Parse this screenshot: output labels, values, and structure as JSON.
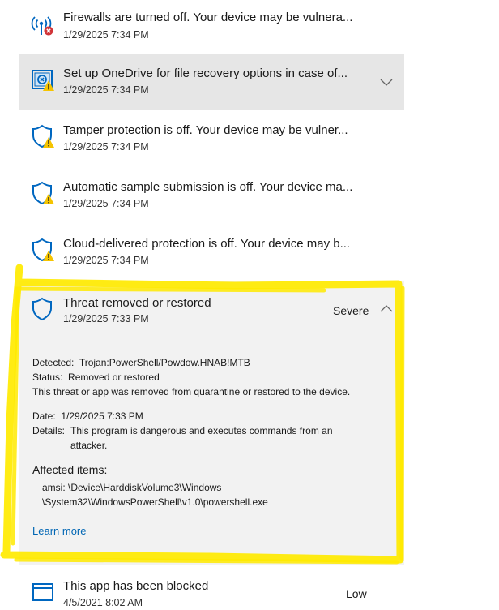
{
  "items": [
    {
      "title": "Firewalls are turned off. Your device may be vulnera...",
      "time": "1/29/2025 7:34 PM",
      "icon": "firewall-error-icon"
    },
    {
      "title": "Set up OneDrive for file recovery options in case of...",
      "time": "1/29/2025 7:34 PM",
      "icon": "onedrive-warning-icon",
      "expand": "chevron-down-icon"
    },
    {
      "title": "Tamper protection is off. Your device may be vulner...",
      "time": "1/29/2025 7:34 PM",
      "icon": "shield-warning-icon"
    },
    {
      "title": "Automatic sample submission is off. Your device ma...",
      "time": "1/29/2025 7:34 PM",
      "icon": "shield-warning-icon"
    },
    {
      "title": "Cloud-delivered protection is off. Your device may b...",
      "time": "1/29/2025 7:34 PM",
      "icon": "shield-warning-icon"
    },
    {
      "title": "Threat removed or restored",
      "time": "1/29/2025 7:33 PM",
      "icon": "shield-icon",
      "severity": "Severe",
      "collapse": "chevron-up-icon",
      "detected_label": "Detected:",
      "detected_value": "Trojan:PowerShell/Powdow.HNAB!MTB",
      "status_label": "Status:",
      "status_value": "Removed or restored",
      "status_desc": "This threat or app was removed from quarantine or restored to the device.",
      "date_label": "Date:",
      "date_value": "1/29/2025 7:33 PM",
      "details_label": "Details:",
      "details_line1": "This program is dangerous and executes commands from an",
      "details_line2": "attacker.",
      "affected_heading": "Affected items:",
      "affected_line1": "amsi: \\Device\\HarddiskVolume3\\Windows",
      "affected_line2": "\\System32\\WindowsPowerShell\\v1.0\\powershell.exe",
      "learn_more": "Learn more"
    },
    {
      "title": "This app has been blocked",
      "time": "4/5/2021 8:02 AM",
      "icon": "app-window-icon",
      "severity": "Low"
    }
  ],
  "colors": {
    "highlight": "#ffea00",
    "link": "#0066b4",
    "warning": "#f5c400",
    "error": "#d13438",
    "icon_blue": "#0067c0"
  }
}
